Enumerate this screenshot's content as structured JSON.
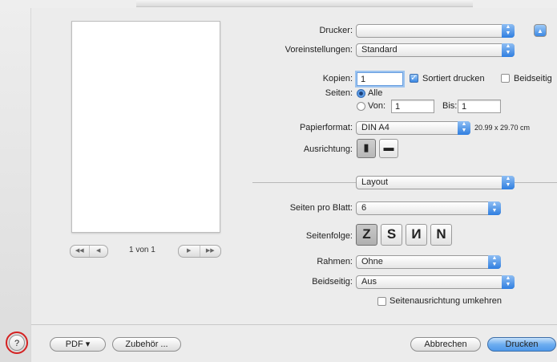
{
  "printer": {
    "label": "Drucker:",
    "value": ""
  },
  "presets": {
    "label": "Voreinstellungen:",
    "value": "Standard"
  },
  "copies": {
    "label": "Kopien:",
    "value": "1",
    "collated_label": "Sortiert drucken",
    "collated": true,
    "duplex_label": "Beidseitig",
    "duplex": false
  },
  "pages": {
    "label": "Seiten:",
    "all_label": "Alle",
    "from_label": "Von:",
    "from_value": "1",
    "to_label": "Bis:",
    "to_value": "1",
    "selected": "Alle"
  },
  "paper": {
    "label": "Papierformat:",
    "value": "DIN A4",
    "size": "20.99 x 29.70 cm"
  },
  "orientation": {
    "label": "Ausrichtung:",
    "options": [
      "portrait-icon",
      "landscape-icon"
    ],
    "selected": "portrait"
  },
  "section": {
    "value": "Layout"
  },
  "layout": {
    "pages_per_sheet_label": "Seiten pro Blatt:",
    "pages_per_sheet": "6",
    "order_label": "Seitenfolge:",
    "order_glyphs": [
      "Z",
      "S",
      "И",
      "N"
    ],
    "border_label": "Rahmen:",
    "border": "Ohne",
    "duplex_label": "Beidseitig:",
    "duplex": "Aus",
    "reverse_label": "Seitenausrichtung umkehren",
    "reverse": false
  },
  "preview": {
    "count": "1 von 1",
    "prev_glyphs": [
      "◀◀",
      "◀"
    ],
    "next_glyphs": [
      "▶",
      "▶▶"
    ]
  },
  "footer": {
    "help": "?",
    "pdf": "PDF ▾",
    "accessories": "Zubehör ...",
    "cancel": "Abbrechen",
    "print": "Drucken"
  },
  "colors": {
    "accent": "#3b88e4",
    "help_ring": "#d42222"
  }
}
